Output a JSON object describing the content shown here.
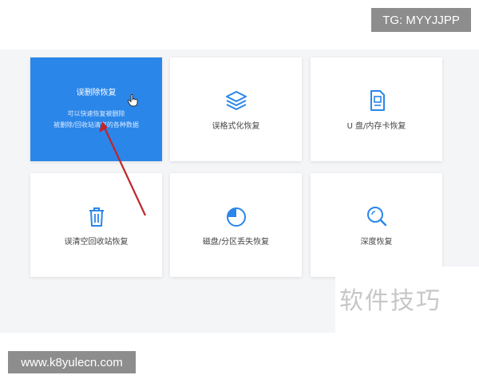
{
  "watermarks": {
    "tg": "TG: MYYJJPP",
    "site": "www.k8yulecn.com",
    "corner": "软件技巧"
  },
  "options": [
    {
      "label": "误删除恢复",
      "desc1": "可以快速恢复被删除",
      "desc2": "被删除/回收站清空的各种数据",
      "icon": "hand-cursor-icon",
      "active": true
    },
    {
      "label": "误格式化恢复",
      "icon": "layers-icon",
      "active": false
    },
    {
      "label": "U 盘/内存卡恢复",
      "icon": "sd-card-icon",
      "active": false
    },
    {
      "label": "误清空回收站恢复",
      "icon": "trash-icon",
      "active": false
    },
    {
      "label": "磁盘/分区丢失恢复",
      "icon": "pie-disk-icon",
      "active": false
    },
    {
      "label": "深度恢复",
      "icon": "search-icon",
      "active": false
    }
  ],
  "colors": {
    "accent": "#2a86e9",
    "icon": "#2a86e9",
    "arrow": "#c0252b"
  }
}
